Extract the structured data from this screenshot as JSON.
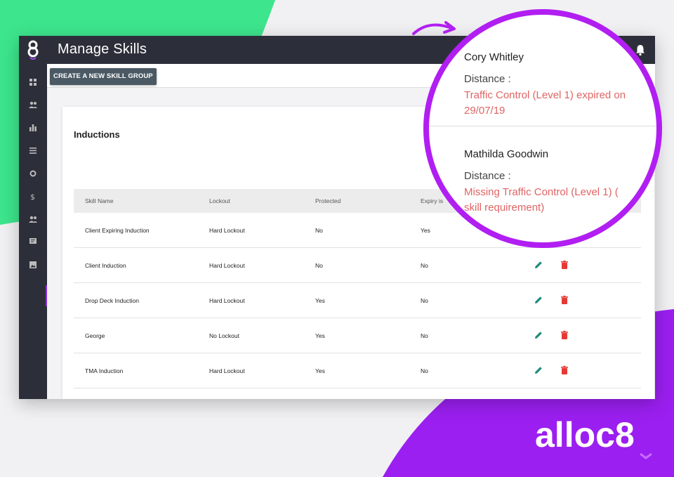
{
  "app": {
    "title": "Manage Skills",
    "create_button_label": "CREATE A NEW SKILL GROUP"
  },
  "sidebar": {
    "items": [
      {
        "icon": "dashboard-icon"
      },
      {
        "icon": "people-icon"
      },
      {
        "icon": "bar-chart-icon"
      },
      {
        "icon": "list-icon"
      },
      {
        "icon": "refresh-icon"
      },
      {
        "icon": "dollar-icon"
      },
      {
        "icon": "group-icon"
      },
      {
        "icon": "message-icon"
      },
      {
        "icon": "image-icon"
      }
    ]
  },
  "section": {
    "title": "Inductions"
  },
  "table": {
    "headers": [
      "Skill Name",
      "Lockout",
      "Protected",
      "Expiry is"
    ],
    "rows": [
      {
        "name": "Client Expiring Induction",
        "lockout": "Hard Lockout",
        "protected": "No",
        "expiry": "Yes"
      },
      {
        "name": "Client Induction",
        "lockout": "Hard Lockout",
        "protected": "No",
        "expiry": "No"
      },
      {
        "name": "Drop Deck Induction",
        "lockout": "Hard Lockout",
        "protected": "Yes",
        "expiry": "No"
      },
      {
        "name": "George",
        "lockout": "No Lockout",
        "protected": "Yes",
        "expiry": "No"
      },
      {
        "name": "TMA Induction",
        "lockout": "Hard Lockout",
        "protected": "Yes",
        "expiry": "No"
      }
    ]
  },
  "popup": {
    "entries": [
      {
        "name": "Cory Whitley",
        "label": "Distance :",
        "message_line1": "Traffic Control (Level 1) expired on",
        "message_line2": "29/07/19"
      },
      {
        "name": "Mathilda Goodwin",
        "label": "Distance :",
        "message_line1": "Missing Traffic Control (Level 1) (",
        "message_line2": "skill requirement)"
      }
    ]
  },
  "logo": {
    "text": "alloc8"
  },
  "colors": {
    "header": "#2c2f39",
    "accent_purple": "#b11ef2",
    "accent_green": "#3ee58a",
    "warning_red": "#e06464",
    "edit_teal": "#1f8a7a",
    "delete_red": "#e53935"
  }
}
